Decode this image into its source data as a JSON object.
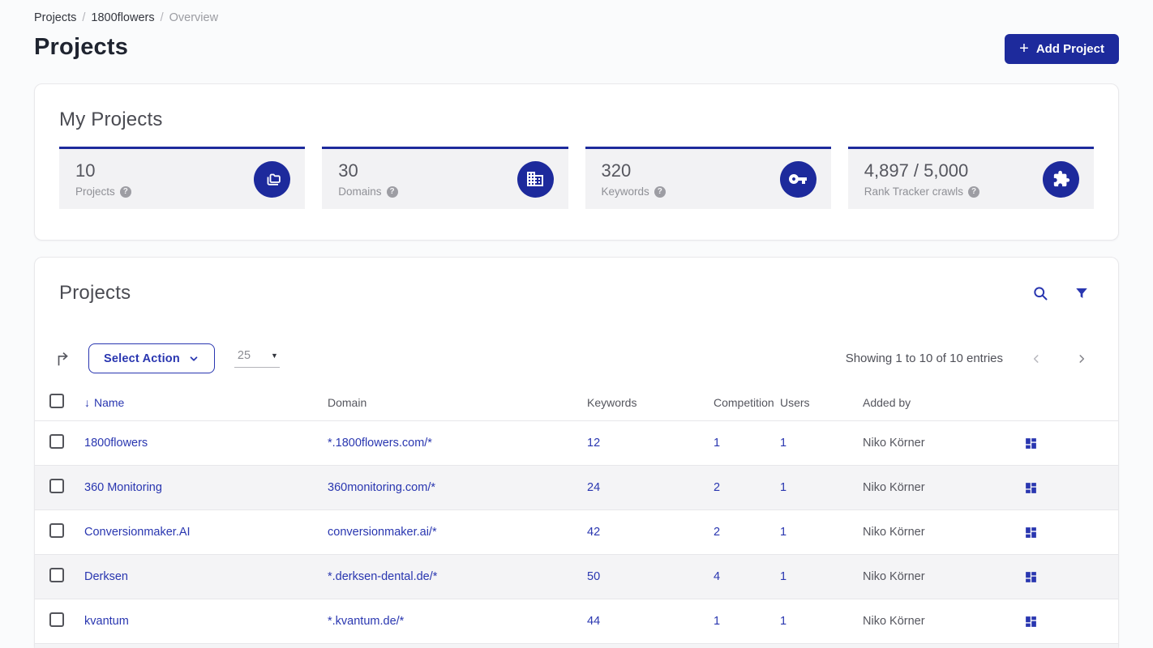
{
  "breadcrumb": {
    "separator": "/",
    "items": [
      {
        "label": "Projects"
      },
      {
        "label": "1800flowers"
      },
      {
        "label": "Overview"
      }
    ]
  },
  "page": {
    "title": "Projects"
  },
  "header": {
    "add_button": {
      "label": "Add Project",
      "plus": "+"
    }
  },
  "my_projects": {
    "title": "My Projects",
    "stats": [
      {
        "value": "10",
        "label": "Projects",
        "icon": "folders-icon"
      },
      {
        "value": "30",
        "label": "Domains",
        "icon": "building-icon"
      },
      {
        "value": "320",
        "label": "Keywords",
        "icon": "key-icon"
      },
      {
        "value": "4,897 / 5,000",
        "label": "Rank Tracker crawls",
        "icon": "puzzle-icon"
      }
    ],
    "help_glyph": "?"
  },
  "projects_panel": {
    "title": "Projects",
    "controls": {
      "select_action_label": "Select Action",
      "page_size": "25",
      "page_size_caret": "▼",
      "showing_text": "Showing 1 to 10 of 10 entries"
    },
    "table": {
      "sort_icon": "↓",
      "headers": {
        "name": "Name",
        "domain": "Domain",
        "keywords": "Keywords",
        "competition": "Competition",
        "users": "Users",
        "added_by": "Added by"
      },
      "rows": [
        {
          "name": "1800flowers",
          "domain": "*.1800flowers.com/*",
          "keywords": "12",
          "competition": "1",
          "users": "1",
          "added_by": "Niko Körner"
        },
        {
          "name": "360 Monitoring",
          "domain": "360monitoring.com/*",
          "keywords": "24",
          "competition": "2",
          "users": "1",
          "added_by": "Niko Körner"
        },
        {
          "name": "Conversionmaker.AI",
          "domain": "conversionmaker.ai/*",
          "keywords": "42",
          "competition": "2",
          "users": "1",
          "added_by": "Niko Körner"
        },
        {
          "name": "Derksen",
          "domain": "*.derksen-dental.de/*",
          "keywords": "50",
          "competition": "4",
          "users": "1",
          "added_by": "Niko Körner"
        },
        {
          "name": "kvantum",
          "domain": "*.kvantum.de/*",
          "keywords": "44",
          "competition": "1",
          "users": "1",
          "added_by": "Niko Körner"
        }
      ]
    }
  },
  "colors": {
    "accent": "#1d2a9c",
    "link": "#2936b0",
    "row_alt": "#f4f4f6",
    "tile_bg": "#f2f2f4"
  }
}
